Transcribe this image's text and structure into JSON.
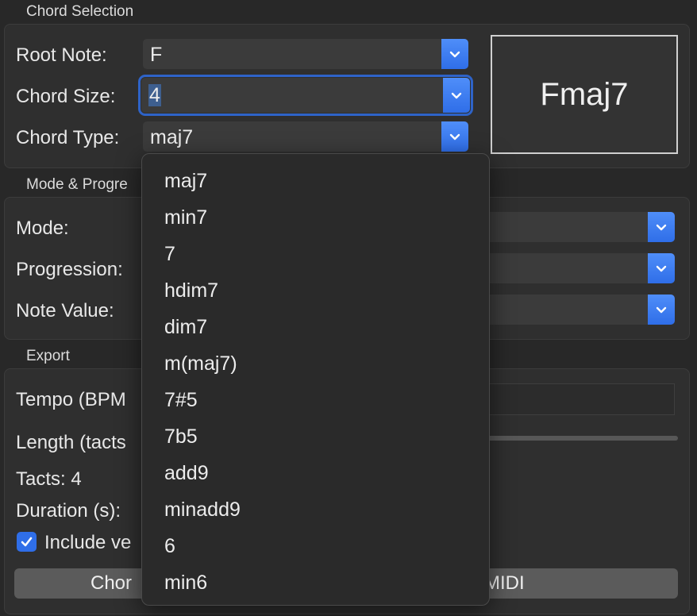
{
  "chord_selection": {
    "title": "Chord Selection",
    "root_label": "Root Note:",
    "root_value": "F",
    "size_label": "Chord Size:",
    "size_value": "4",
    "type_label": "Chord Type:",
    "type_value": "maj7",
    "display": "Fmaj7"
  },
  "mode_progression": {
    "title": "Mode & Progre",
    "mode_label": "Mode:",
    "progression_label": "Progression:",
    "note_value_label": "Note Value:"
  },
  "export": {
    "title": "Export",
    "tempo_label": "Tempo (BPM",
    "length_label": "Length (tacts",
    "tacts_label": "Tacts: 4",
    "duration_label": "Duration (s):",
    "include_label": "Include ve",
    "include_checked": true,
    "button_left": "Chor",
    "button_right": "MIDI"
  },
  "chord_type_dropdown": {
    "options": [
      "maj7",
      "min7",
      "7",
      "hdim7",
      "dim7",
      "m(maj7)",
      "7#5",
      "7b5",
      "add9",
      "minadd9",
      "6",
      "min6"
    ]
  },
  "colors": {
    "accent": "#2f6ee8",
    "background": "#282828",
    "group": "#2f2f2f"
  }
}
